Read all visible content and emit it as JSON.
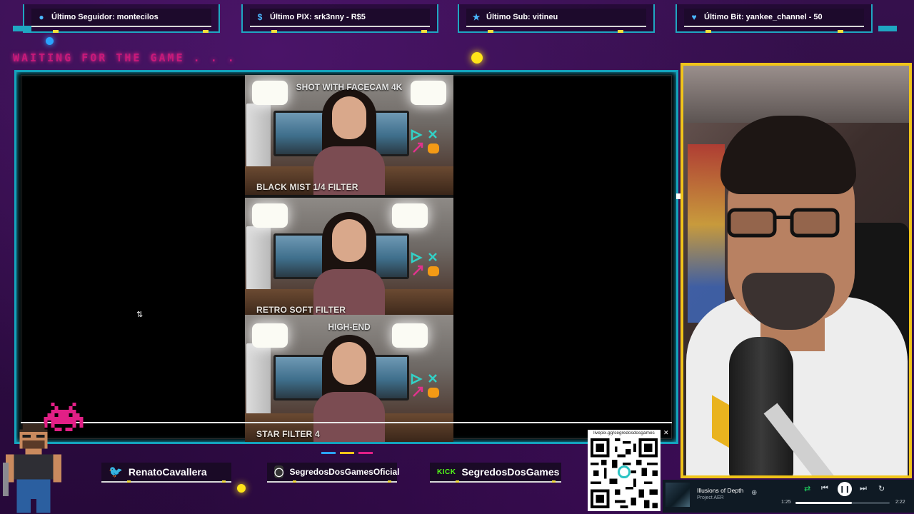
{
  "alerts": [
    {
      "icon": "user-icon",
      "text": "Último Seguidor: montecilos"
    },
    {
      "icon": "dollar-icon",
      "text": "Último PIX: srk3nny - R$5"
    },
    {
      "icon": "star-icon",
      "text": "Último Sub: vitineu"
    },
    {
      "icon": "heart-icon",
      "text": "Último Bit: yankee_channel - 50"
    }
  ],
  "status_text": "WAITING FOR THE GAME . . .",
  "video_panels": [
    {
      "top_caption": "SHOT WITH FACECAM 4K",
      "bottom_caption": "BLACK MIST 1/4 FILTER"
    },
    {
      "top_caption": "",
      "bottom_caption": "RETRO SOFT FILTER"
    },
    {
      "top_caption": "HIGH-END",
      "bottom_caption": "STAR FILTER 4"
    }
  ],
  "socials": {
    "twitter": "RenatoCavallera",
    "instagram": "SegredosDosGamesOficial",
    "kick_label": "KICK",
    "kick": "SegredosDosGames"
  },
  "qr": {
    "label": "livepix.gg/segredosdosgames"
  },
  "player": {
    "title": "Illusions of Depth",
    "artist": "Project AER",
    "elapsed": "1:25",
    "duration": "2:22",
    "progress": 0.6
  },
  "colors": {
    "background": "#2a0a3d",
    "frame_cyan": "#14a3bd",
    "accent_yellow": "#ffe419",
    "accent_pink": "#c8197a",
    "cam_border": "#f0c419"
  }
}
